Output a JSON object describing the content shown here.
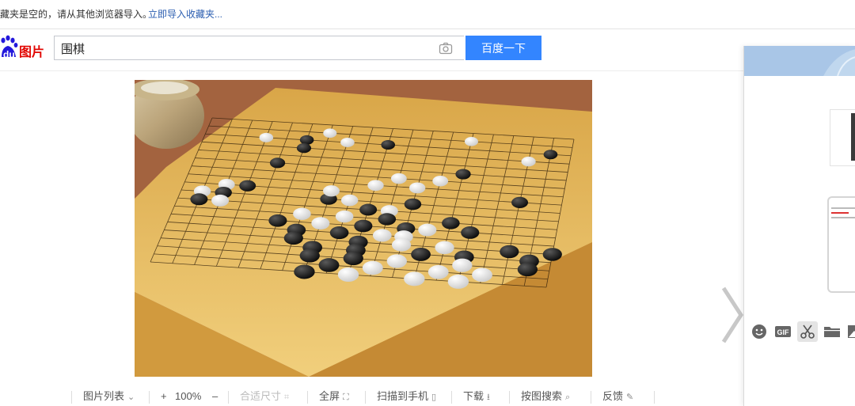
{
  "bookmark_bar": {
    "message": "藏夹是空的，请从其他浏览器导入。",
    "import_link": "立即导入收藏夹..."
  },
  "search": {
    "query": "围棋",
    "button_label": "百度一下",
    "logo_text": "图片",
    "logo_du": "du"
  },
  "toolbar": {
    "image_list": "图片列表",
    "zoom_in": "+",
    "zoom_level": "100%",
    "zoom_out": "–",
    "fit_size": "合适尺寸",
    "fullscreen": "全屏",
    "scan_to_phone": "扫描到手机",
    "download": "下载",
    "search_by_image": "按图搜索",
    "feedback": "反馈"
  },
  "side_panel": {
    "tool_icons": [
      "smiley-icon",
      "gif-icon",
      "scissors-icon",
      "folder-icon",
      "image-icon"
    ],
    "gif_label": "GIF"
  },
  "image": {
    "subject": "go-board",
    "board_color": "#e6b85c",
    "black_stone_color": "#1a1a1a",
    "white_stone_color": "#f1f1f1"
  },
  "colors": {
    "accent": "#3385ff",
    "logo_red": "#e10602",
    "logo_blue": "#2319dc",
    "link": "#2a5db0"
  }
}
